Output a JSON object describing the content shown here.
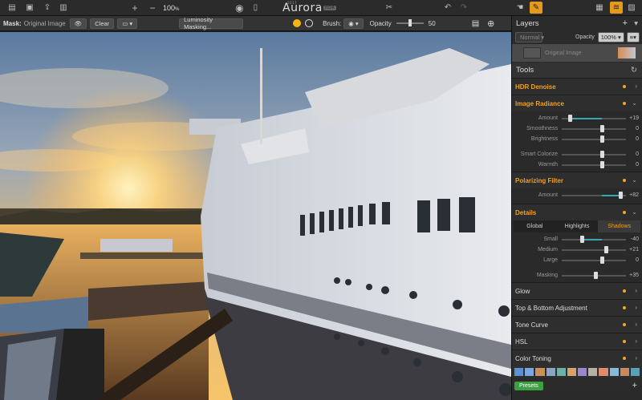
{
  "app": {
    "logo_text": "Aurora",
    "logo_badge": "HDR",
    "logo_year": "2017"
  },
  "topbar": {
    "zoom_minus": "−",
    "zoom_plus": "+",
    "zoom_level": "100",
    "zoom_unit": "%"
  },
  "maskbar": {
    "mask_label": "Mask:",
    "mask_name": "Original Image",
    "clear_label": "Clear",
    "luminosity_label": "Luminosity Masking...",
    "brush_label": "Brush:",
    "opacity_label": "Opacity",
    "opacity_value": "50"
  },
  "layers": {
    "title": "Layers",
    "add": "+",
    "blend_mode": "Normal",
    "opacity_label": "Opacity",
    "opacity_value": "100%",
    "layer_name": "Original Image"
  },
  "tools": {
    "title": "Tools",
    "hdr_denoise": "HDR Denoise",
    "image_radiance": {
      "title": "Image Radiance",
      "rows": [
        {
          "label": "Amount",
          "value": "+19",
          "pos": 0.12,
          "fill": true
        },
        {
          "label": "Smoothness",
          "value": "0",
          "pos": 0.62
        },
        {
          "label": "Brightness",
          "value": "0",
          "pos": 0.62
        },
        {
          "label": "Smart Colorize",
          "value": "0",
          "pos": 0.62
        },
        {
          "label": "Warmth",
          "value": "0",
          "pos": 0.62
        }
      ]
    },
    "polarizing": {
      "title": "Polarizing Filter",
      "amount_label": "Amount",
      "amount_value": "+82",
      "pos": 0.91
    },
    "details": {
      "title": "Details",
      "tabs": [
        "Global",
        "Highlights",
        "Shadows"
      ],
      "rows": [
        {
          "label": "Small",
          "value": "-40",
          "pos": 0.31
        },
        {
          "label": "Medium",
          "value": "+21",
          "pos": 0.69
        },
        {
          "label": "Large",
          "value": "0",
          "pos": 0.62
        },
        {
          "label": "Masking",
          "value": "+35",
          "pos": 0.52
        }
      ]
    },
    "collapsed": [
      "Glow",
      "Top & Bottom Adjustment",
      "Tone Curve",
      "HSL",
      "Color Toning"
    ],
    "presets_label": "Presets",
    "presets_add": "+",
    "swatches": [
      "#5b8fd6",
      "#7aa7e0",
      "#c9905a",
      "#8aa6c6",
      "#6cb0a8",
      "#d4a36a",
      "#9e84c8",
      "#b3b3a0",
      "#e28a6a",
      "#8bb8d9",
      "#c88a5d",
      "#5a9fb5"
    ]
  }
}
